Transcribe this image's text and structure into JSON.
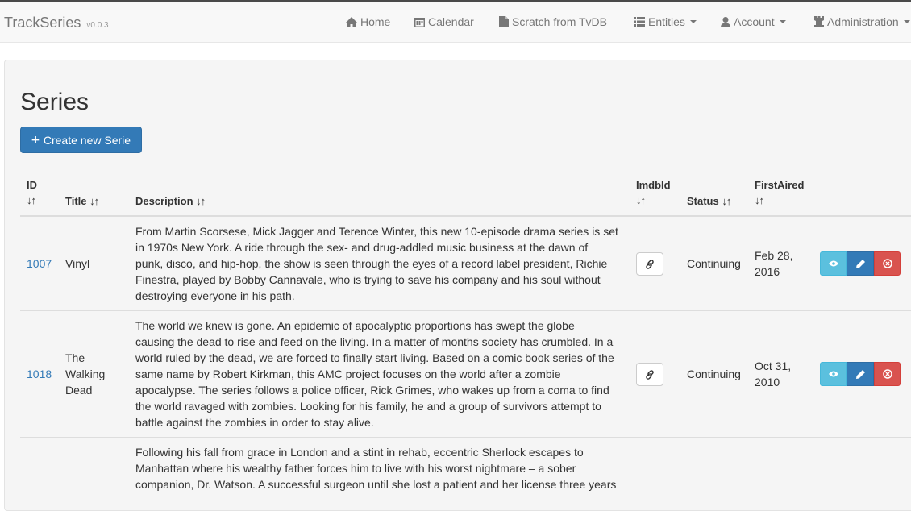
{
  "navbar": {
    "brand": "TrackSeries",
    "version": "v0.0.3",
    "items": [
      {
        "label": "Home",
        "icon": "home-icon"
      },
      {
        "label": "Calendar",
        "icon": "calendar-icon"
      },
      {
        "label": "Scratch from TvDB",
        "icon": "document-icon"
      },
      {
        "label": "Entities",
        "icon": "list-icon"
      },
      {
        "label": "Account",
        "icon": "user-icon"
      },
      {
        "label": "Administration",
        "icon": "tower-icon"
      }
    ]
  },
  "page": {
    "title": "Series",
    "create_button": "Create new Serie"
  },
  "table": {
    "headers": {
      "id": "ID",
      "title": "Title",
      "description": "Description",
      "imdbid": "ImdbId",
      "status": "Status",
      "firstaired": "FirstAired",
      "sort_glyph": "↓↑"
    },
    "rows": [
      {
        "id": "1007",
        "title_lines": [
          "Vinyl"
        ],
        "description_lines": [
          "From Martin Scorsese, Mick Jagger and Terence Winter, this new 10-episode drama series is set",
          "in 1970s New York. A ride through the sex- and drug-addled music business at the dawn of",
          "punk, disco, and hip-hop, the show is seen through the eyes of a record label president, Richie",
          "Finestra, played by Bobby Cannavale, who is trying to save his company and his soul without",
          "destroying everyone in his path."
        ],
        "status": "Continuing",
        "firstaired_lines": [
          "Feb 28,",
          "2016"
        ]
      },
      {
        "id": "1018",
        "title_lines": [
          "The",
          "Walking",
          "Dead"
        ],
        "description_lines": [
          "The world we knew is gone. An epidemic of apocalyptic proportions has swept the globe",
          "causing the dead to rise and feed on the living. In a matter of months society has crumbled. In a",
          "world ruled by the dead, we are forced to finally start living. Based on a comic book series of the",
          "same name by Robert Kirkman, this AMC project focuses on the world after a zombie",
          "apocalypse. The series follows a police officer, Rick Grimes, who wakes up from a coma to find",
          "the world ravaged with zombies. Looking for his family, he and a group of survivors attempt to",
          "battle against the zombies in order to stay alive."
        ],
        "status": "Continuing",
        "firstaired_lines": [
          "Oct 31,",
          "2010"
        ]
      },
      {
        "description_lines": [
          "Following his fall from grace in London and a stint in rehab, eccentric Sherlock escapes to",
          "Manhattan where his wealthy father forces him to live with his worst nightmare – a sober",
          "companion, Dr. Watson. A successful surgeon until she lost a patient and her license three years"
        ]
      }
    ]
  },
  "colors": {
    "primary": "#337ab7",
    "info": "#5bc0de",
    "danger": "#d9534f"
  }
}
